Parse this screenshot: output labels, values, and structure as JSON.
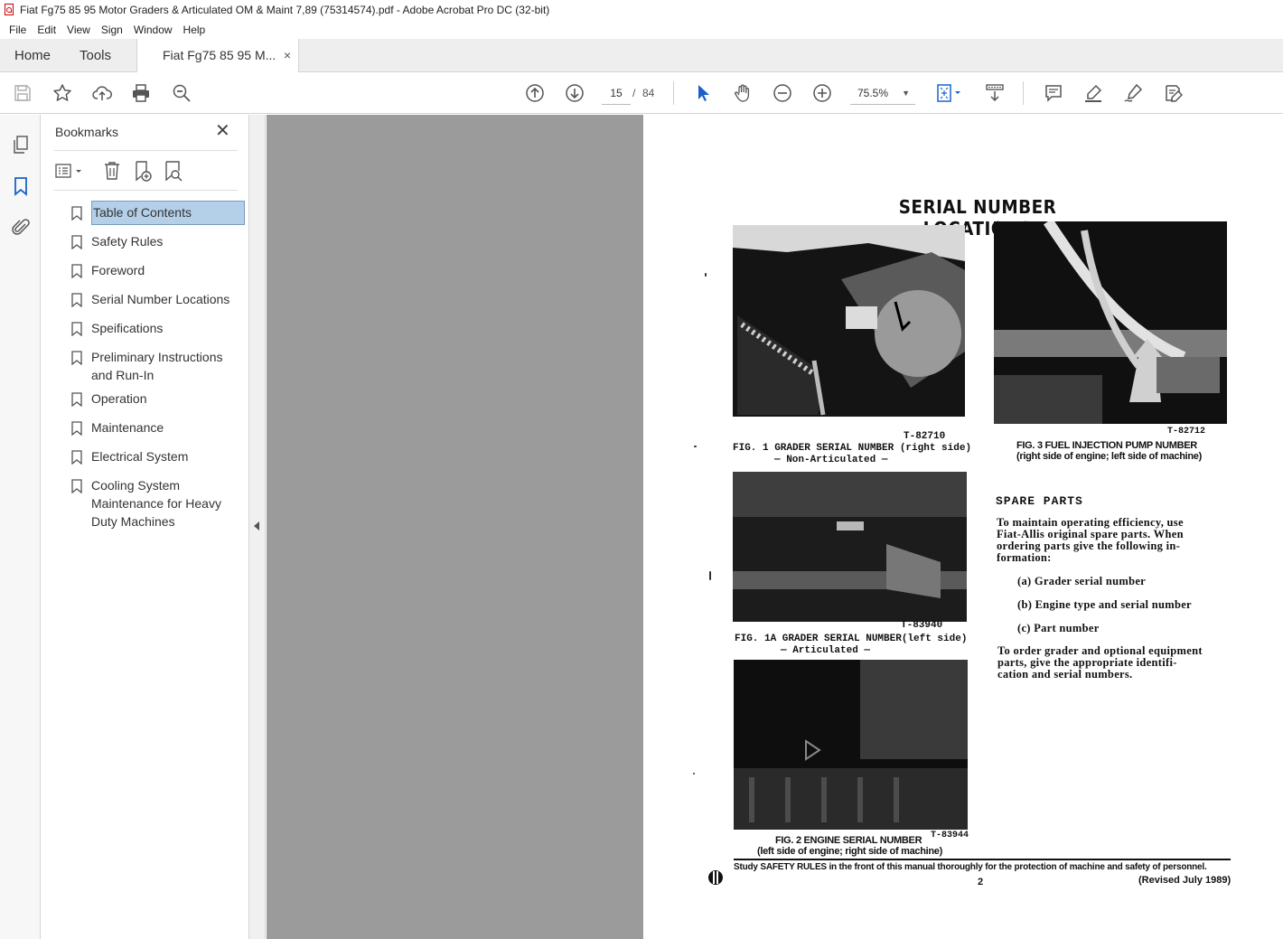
{
  "window": {
    "title": "Fiat Fg75 85 95 Motor Graders & Articulated OM & Maint 7,89 (75314574).pdf - Adobe Acrobat Pro DC (32-bit)"
  },
  "menu": [
    "File",
    "Edit",
    "View",
    "Sign",
    "Window",
    "Help"
  ],
  "tabs": {
    "home": "Home",
    "tools": "Tools",
    "document": "Fiat Fg75 85 95 M...",
    "close": "×"
  },
  "toolbar": {
    "page_current": "15",
    "page_separator": "/",
    "page_total": "84",
    "zoom": "75.5%"
  },
  "bookmarks": {
    "title": "Bookmarks",
    "close": "✕",
    "items": [
      {
        "label": "Table of Contents",
        "selected": true
      },
      {
        "label": "Safety Rules"
      },
      {
        "label": "Foreword"
      },
      {
        "label": "Serial Number Locations"
      },
      {
        "label": "Speifications"
      },
      {
        "label": "Preliminary Instructions and Run-In"
      },
      {
        "label": "Operation"
      },
      {
        "label": "Maintenance"
      },
      {
        "label": "Electrical System"
      },
      {
        "label": "Cooling System Maintenance for Heavy Duty Machines"
      }
    ]
  },
  "page": {
    "title": "SERIAL NUMBER LOCATIONS",
    "fig1_code": "T-82710",
    "fig1_caption": "FIG. 1 GRADER SERIAL NUMBER (right side)",
    "fig1_sub": "— Non-Articulated —",
    "fig3_code": "T-82712",
    "fig3_caption": "FIG. 3  FUEL INJECTION PUMP NUMBER",
    "fig3_sub": "(right side of engine; left side of machine)",
    "fig1a_code": "T-83940",
    "fig1a_caption": "FIG. 1A GRADER SERIAL NUMBER(left side)",
    "fig1a_sub": "— Articulated —",
    "fig2_code": "T-83944",
    "fig2_caption": "FIG. 2 ENGINE SERIAL NUMBER",
    "fig2_sub": "(left side of engine; right  side of machine)",
    "spare_heading": "SPARE PARTS",
    "spare_p1_l1": "To maintain operating efficiency, use",
    "spare_p1_l2": "Fiat-Allis original spare parts. When",
    "spare_p1_l3": "ordering parts give the following in-",
    "spare_p1_l4": "formation:",
    "list_a": "(a) Grader serial number",
    "list_b": "(b) Engine type and serial number",
    "list_c": "(c) Part number",
    "spare_p2_l1": "To order grader and optional equipment",
    "spare_p2_l2": "parts, give the appropriate identifi-",
    "spare_p2_l3": "cation and serial numbers.",
    "footer": "Study SAFETY RULES in the front of this manual thoroughly for the protection of machine and safety of personnel.",
    "page_number": "2",
    "revised": "(Revised July 1989)"
  }
}
